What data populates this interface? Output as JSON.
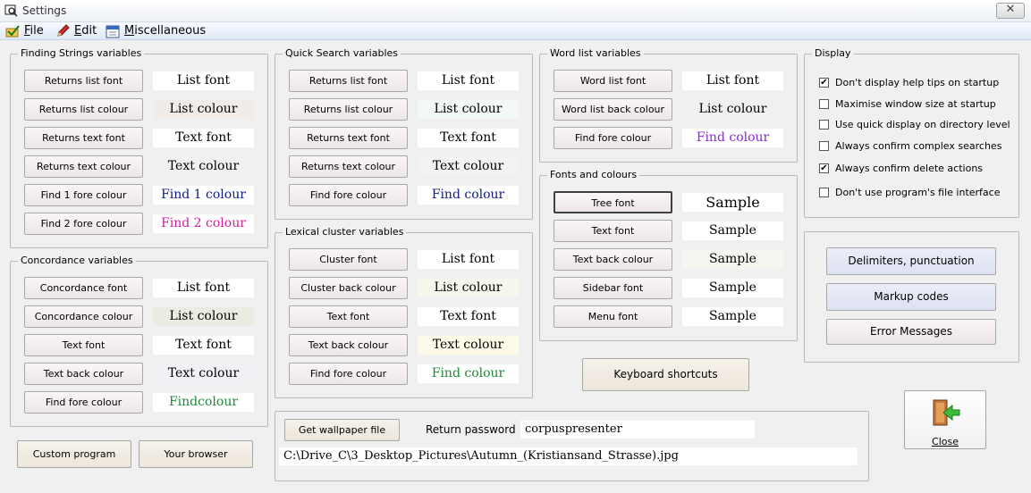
{
  "window": {
    "title": "Settings",
    "close_glyph": "✕"
  },
  "menu": {
    "file": "File",
    "edit": "Edit",
    "misc": "Miscellaneous"
  },
  "finding": {
    "title": "Finding Strings variables",
    "rows": [
      {
        "button": "Returns list font",
        "sample": "List font",
        "color": "#000000",
        "bg": "#ffffff"
      },
      {
        "button": "Returns list colour",
        "sample": "List colour",
        "color": "#000000",
        "bg": "#f2ece9"
      },
      {
        "button": "Returns text font",
        "sample": "Text font",
        "color": "#000000",
        "bg": "#ffffff"
      },
      {
        "button": "Returns text colour",
        "sample": "Text colour",
        "color": "#000000",
        "bg": "#f0f0f0"
      },
      {
        "button": "Find 1 fore colour",
        "sample": "Find 1 colour",
        "color": "#101a8a",
        "bg": "#ffffff"
      },
      {
        "button": "Find 2 fore colour",
        "sample": "Find 2 colour",
        "color": "#d3209a",
        "bg": "#ffffff"
      }
    ]
  },
  "quick": {
    "title": "Quick Search variables",
    "rows": [
      {
        "button": "Returns list font",
        "sample": "List font",
        "color": "#000000",
        "bg": "#ffffff"
      },
      {
        "button": "Returns list colour",
        "sample": "List colour",
        "color": "#000000",
        "bg": "#f2f8f3"
      },
      {
        "button": "Returns text font",
        "sample": "Text font",
        "color": "#000000",
        "bg": "#ffffff"
      },
      {
        "button": "Returns text colour",
        "sample": "Text colour",
        "color": "#000000",
        "bg": "#f2f2f2"
      },
      {
        "button": "Find fore colour",
        "sample": "Find colour",
        "color": "#101a8a",
        "bg": "#ffffff"
      }
    ]
  },
  "wordlist": {
    "title": "Word list variables",
    "rows": [
      {
        "button": "Word list font",
        "sample": "List font",
        "color": "#000000",
        "bg": "#ffffff"
      },
      {
        "button": "Word list back colour",
        "sample": "List colour",
        "color": "#000000",
        "bg": "#f0f0f0"
      },
      {
        "button": "Find fore colour",
        "sample": "Find colour",
        "color": "#8a2ad0",
        "bg": "#ffffff"
      }
    ]
  },
  "display": {
    "title": "Display",
    "options": [
      {
        "label": "Don't display help tips on startup",
        "checked": true
      },
      {
        "label": "Maximise window size at startup",
        "checked": false
      },
      {
        "label": "Use quick display on directory level",
        "checked": false
      },
      {
        "label": "Always confirm complex searches",
        "checked": false
      },
      {
        "label": "Always confirm delete actions",
        "checked": true
      },
      {
        "label": "Don't use program's file  interface",
        "checked": false
      }
    ]
  },
  "fonts": {
    "title": "Fonts and colours",
    "rows": [
      {
        "button": "Tree font",
        "sample": "Sample",
        "color": "#000000",
        "bg": "#ffffff"
      },
      {
        "button": "Text font",
        "sample": "Sample",
        "color": "#000000",
        "bg": "#ffffff"
      },
      {
        "button": "Text back colour",
        "sample": "Sample",
        "color": "#000000",
        "bg": "#f5f6f0"
      },
      {
        "button": "Sidebar font",
        "sample": "Sample",
        "color": "#000000",
        "bg": "#ffffff"
      },
      {
        "button": "Menu font",
        "sample": "Sample",
        "color": "#000000",
        "bg": "#ffffff"
      }
    ]
  },
  "right": {
    "delimiters": "Delimiters, punctuation",
    "markup": "Markup codes",
    "errors": "Error Messages"
  },
  "concordance": {
    "title": "Concordance variables",
    "rows": [
      {
        "button": "Concordance font",
        "sample": "List font",
        "color": "#000000",
        "bg": "#ffffff"
      },
      {
        "button": "Concordance colour",
        "sample": "List colour",
        "color": "#000000",
        "bg": "#ecebe1"
      },
      {
        "button": "Text font",
        "sample": "Text font",
        "color": "#000000",
        "bg": "#ffffff"
      },
      {
        "button": "Text back colour",
        "sample": "Text colour",
        "color": "#000000",
        "bg": "#f0f0f5"
      },
      {
        "button": "Find fore colour",
        "sample": "Findcolour",
        "color": "#1e8a3a",
        "bg": "#ffffff"
      }
    ]
  },
  "lexical": {
    "title": "Lexical cluster variables",
    "rows": [
      {
        "button": "Cluster font",
        "sample": "List font",
        "color": "#000000",
        "bg": "#ffffff"
      },
      {
        "button": "Cluster back colour",
        "sample": "List colour",
        "color": "#000000",
        "bg": "#f5f6ec"
      },
      {
        "button": "Text font",
        "sample": "Text font",
        "color": "#000000",
        "bg": "#ffffff"
      },
      {
        "button": "Text back colour",
        "sample": "Text colour",
        "color": "#000000",
        "bg": "#fdfbe8"
      },
      {
        "button": "Find fore colour",
        "sample": "Find colour",
        "color": "#1e8a3a",
        "bg": "#ffffff"
      }
    ]
  },
  "keyboard": "Keyboard shortcuts",
  "bottom": {
    "custom": "Custom program",
    "browser": "Your browser",
    "wallpaper_button": "Get wallpaper file",
    "password_label": "Return password",
    "password_value": "corpuspresenter",
    "path_value": "C:\\Drive_C\\3_Desktop_Pictures\\Autumn_(Kristiansand_Strasse).jpg"
  },
  "close": {
    "label": "Close"
  }
}
